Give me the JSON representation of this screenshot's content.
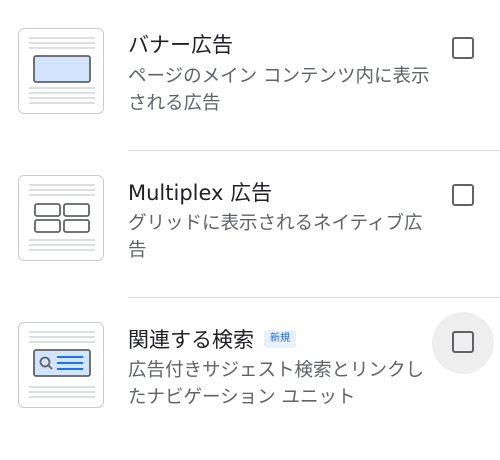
{
  "items": [
    {
      "title": "バナー広告",
      "description": "ページのメイン コンテンツ内に表示される広告",
      "checked": false,
      "icon": "banner-ad-icon"
    },
    {
      "title": "Multiplex 広告",
      "description": "グリッドに表示されるネイティブ広告",
      "checked": false,
      "icon": "multiplex-grid-icon"
    },
    {
      "title": "関連する検索",
      "badge": "新規",
      "description": "広告付きサジェスト検索とリンクしたナビゲーション ユニット",
      "checked": false,
      "icon": "related-search-icon"
    }
  ],
  "colors": {
    "text_primary": "#202124",
    "text_secondary": "#5f6368",
    "badge_bg": "#e8f0fe",
    "badge_text": "#1967d2",
    "banner_fill": "#d2e3fc",
    "icon_stroke": "#5f6368",
    "line_gray": "#c9ccd1"
  }
}
